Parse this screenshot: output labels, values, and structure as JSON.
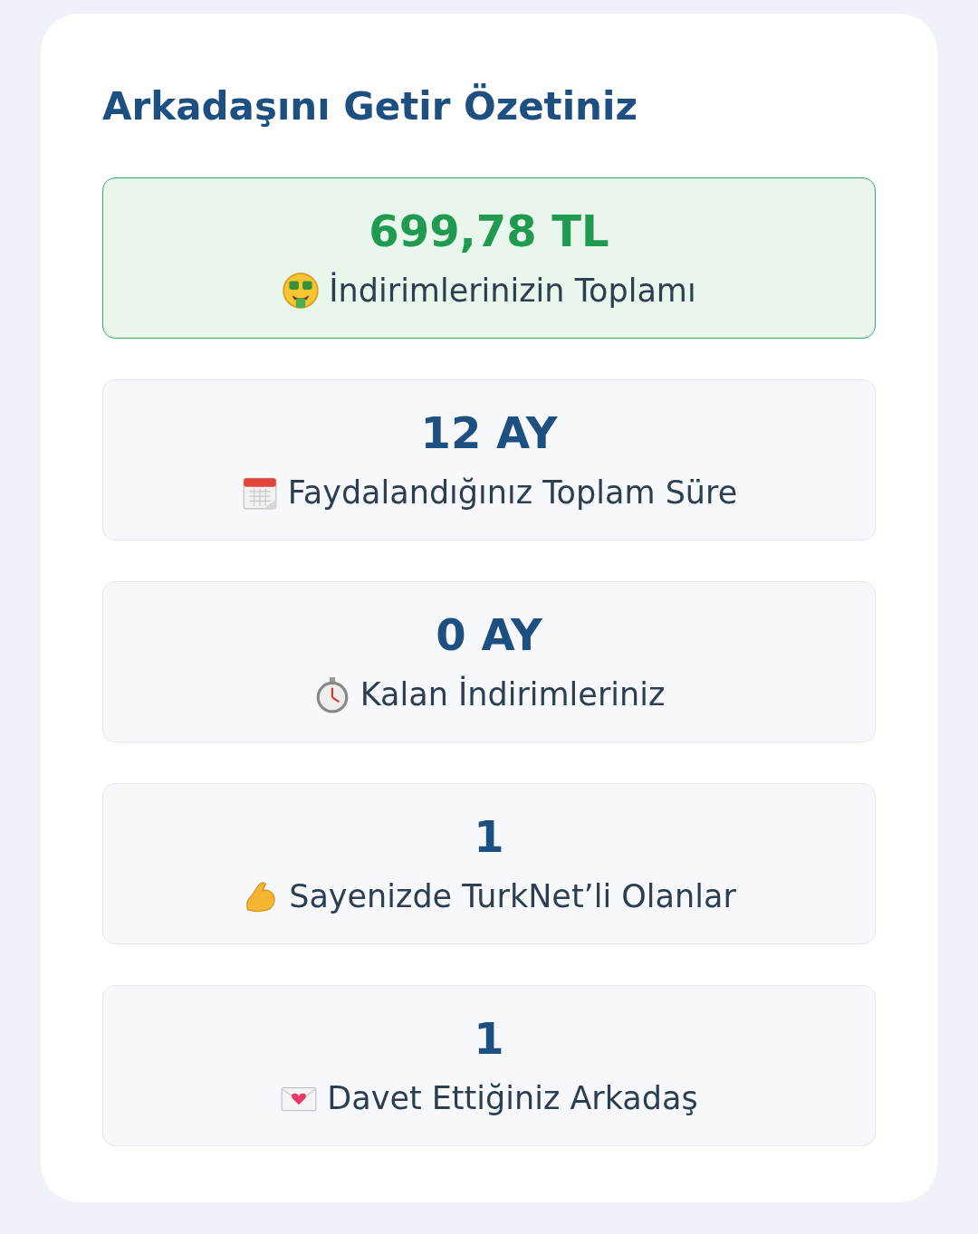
{
  "title": "Arkadaşını Getir Özetiniz",
  "stats": [
    {
      "value": "699,78 TL",
      "label": "İndirimlerinizin Toplamı",
      "kind": "money",
      "highlighted": true
    },
    {
      "value": "12 AY",
      "label": "Faydalandığınız Toplam Süre",
      "kind": "calendar",
      "highlighted": false
    },
    {
      "value": "0 AY",
      "label": "Kalan İndirimleriniz",
      "kind": "stopwatch",
      "highlighted": false
    },
    {
      "value": "1",
      "label": "Sayenizde TurkNet’li Olanlar",
      "kind": "muscle",
      "highlighted": false
    },
    {
      "value": "1",
      "label": "Davet Ettiğiniz Arkadaş",
      "kind": "letter",
      "highlighted": false
    }
  ]
}
